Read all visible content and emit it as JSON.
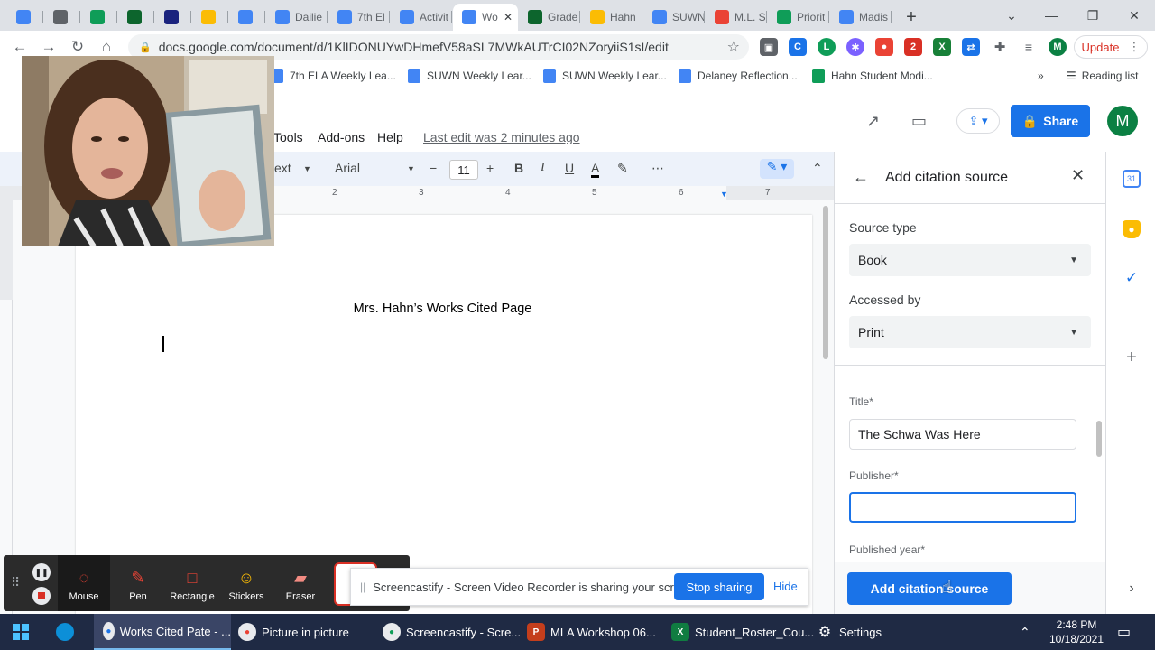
{
  "browser": {
    "tabs": [
      {
        "label": "",
        "color": "#4285f4"
      },
      {
        "label": "",
        "color": "#5f6368"
      },
      {
        "label": "",
        "color": "#0f9d58"
      },
      {
        "label": "",
        "color": "#0d652d"
      },
      {
        "label": "",
        "color": "#1a237e"
      },
      {
        "label": "",
        "color": "#fbbc04"
      },
      {
        "label": "",
        "color": "#4285f4"
      },
      {
        "label": "Dailie",
        "color": "#4285f4"
      },
      {
        "label": "7th El",
        "color": "#4285f4"
      },
      {
        "label": "Activit",
        "color": "#4285f4"
      },
      {
        "label": "Wo",
        "color": "#4285f4"
      },
      {
        "label": "Grade",
        "color": "#0d652d"
      },
      {
        "label": "Hahn",
        "color": "#fbbc04"
      },
      {
        "label": "SUWN",
        "color": "#4285f4"
      },
      {
        "label": "M.L. S",
        "color": "#ea4335"
      },
      {
        "label": "Priorit",
        "color": "#0f9d58"
      },
      {
        "label": "Madis",
        "color": "#4285f4"
      }
    ],
    "url": "docs.google.com/document/d/1KlIDONUYwDHmefV58aSL7MWkAUTrCI02NZoryiiS1sI/edit",
    "update_label": "Update",
    "bookmarks": [
      "7th ELA Weekly Lea...",
      "SUWN Weekly Lear...",
      "SUWN Weekly Lear...",
      "Delaney Reflection...",
      "Hahn Student Modi..."
    ],
    "reading_list": "Reading list"
  },
  "docs": {
    "menus": [
      "Tools",
      "Add-ons",
      "Help"
    ],
    "last_edit": "Last edit was 2 minutes ago",
    "share_label": "Share",
    "avatar_letter": "M",
    "style_partial": "ext",
    "font": "Arial",
    "font_size": "11",
    "ruler_ticks": [
      "2",
      "3",
      "4",
      "5",
      "6",
      "7"
    ],
    "page_title": "Mrs. Hahn’s Works Cited Page"
  },
  "citation_panel": {
    "title": "Add citation source",
    "source_type_label": "Source type",
    "source_type_value": "Book",
    "accessed_by_label": "Accessed by",
    "accessed_by_value": "Print",
    "title_label": "Title*",
    "title_value": "The Schwa Was Here",
    "publisher_label": "Publisher*",
    "publisher_value": "",
    "year_label": "Published year*",
    "add_button": "Add citation source"
  },
  "screencastify": {
    "tools": [
      "Mouse",
      "Pen",
      "Rectangle",
      "Stickers",
      "Eraser"
    ],
    "notice": "Screencastify - Screen Video Recorder is sharing your screen.",
    "stop_label": "Stop sharing",
    "hide_label": "Hide"
  },
  "taskbar": {
    "items": [
      "Works Cited Pate - ...",
      "Picture in picture",
      "Screencastify - Scre...",
      "MLA Workshop 06...",
      "Student_Roster_Cou...",
      "Settings"
    ],
    "time": "2:48 PM",
    "date": "10/18/2021"
  }
}
